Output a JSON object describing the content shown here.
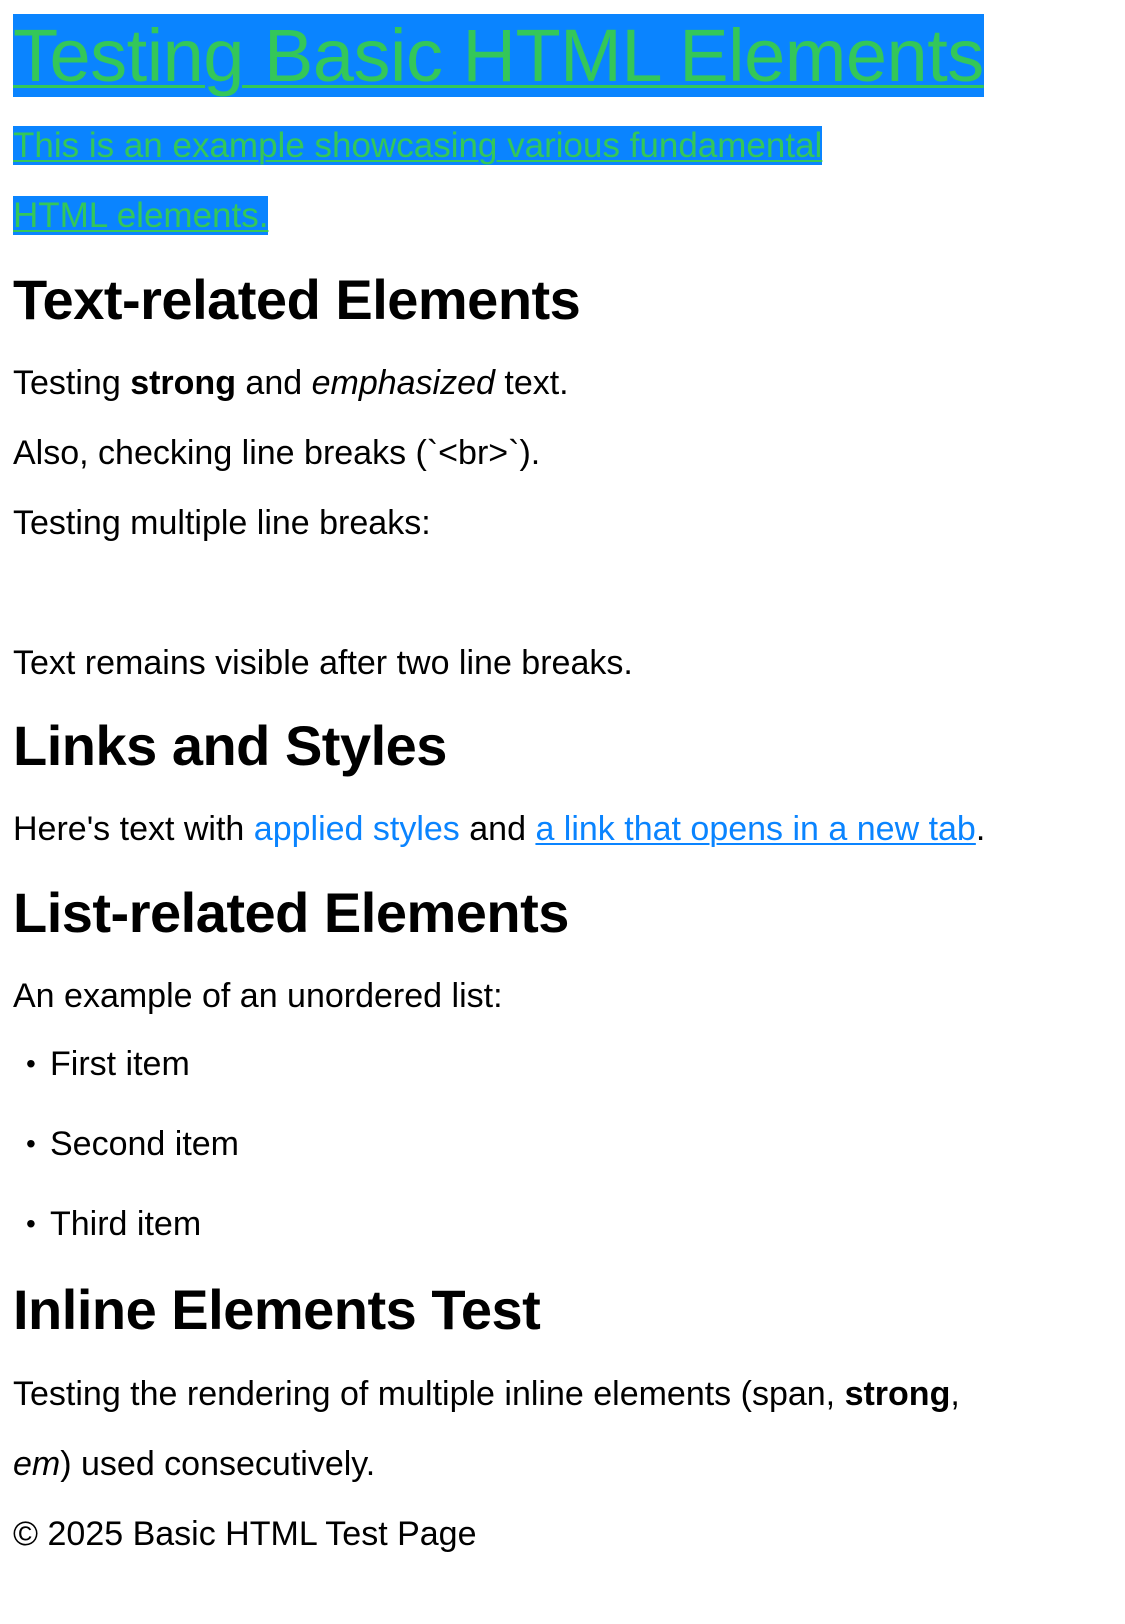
{
  "header": {
    "title": "Testing Basic HTML Elements",
    "subtitle_line1": "This is an example showcasing various fundamental ",
    "subtitle_line2": "HTML elements."
  },
  "text_section": {
    "heading": "Text-related Elements",
    "strong_line": {
      "pre": "Testing ",
      "strong": "strong",
      "mid": " and ",
      "em": "emphasized",
      "post": " text."
    },
    "br_line": "Also, checking line breaks (`<br>`).",
    "multi_break_line": "Testing multiple line breaks:",
    "after_break_line": "Text remains visible after two line breaks."
  },
  "links_section": {
    "heading": "Links and Styles",
    "pre": "Here's text with ",
    "styled_text": "applied styles",
    "mid": " and ",
    "link_text": "a link that opens in a new tab",
    "post": "."
  },
  "list_section": {
    "heading": "List-related Elements",
    "intro": "An example of an unordered list:",
    "items": [
      "First item",
      "Second item",
      "Third item"
    ]
  },
  "inline_section": {
    "heading": "Inline Elements Test",
    "line1_pre": "Testing the rendering of multiple inline elements (span, ",
    "line1_strong": "strong",
    "line1_post": ",",
    "line2_em": "em",
    "line2_post": ") used consecutively."
  },
  "footer": {
    "text": "© 2025 Basic HTML Test Page"
  },
  "colors": {
    "highlight_bg": "#0a84ff",
    "highlight_text": "#34c759",
    "link": "#0a84ff"
  }
}
